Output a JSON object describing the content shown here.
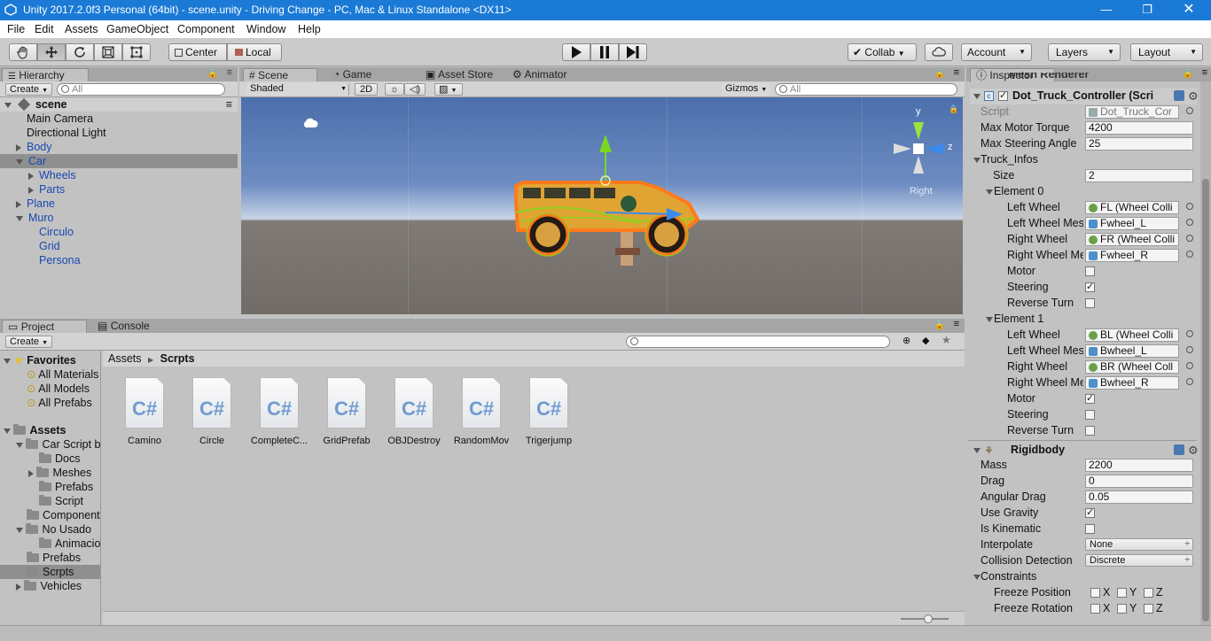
{
  "window": {
    "title": "Unity 2017.2.0f3 Personal (64bit) - scene.unity - Driving Change - PC, Mac & Linux Standalone <DX11>",
    "min_icon": "minimize-icon",
    "max_icon": "maximize-icon",
    "close_icon": "close-icon"
  },
  "menu": [
    "File",
    "Edit",
    "Assets",
    "GameObject",
    "Component",
    "Window",
    "Help"
  ],
  "toolbar": {
    "pivot": "Center",
    "space": "Local",
    "collab": "Collab",
    "account": "Account",
    "layers": "Layers",
    "layout": "Layout"
  },
  "hierarchy": {
    "tab": "Hierarchy",
    "create": "Create",
    "search_placeholder": "All",
    "scene": "scene",
    "items": [
      "Main Camera",
      "Directional Light",
      "Body",
      "Car",
      "Wheels",
      "Parts",
      "Plane",
      "Muro",
      "Circulo",
      "Grid",
      "Persona"
    ]
  },
  "scene_view": {
    "tabs": [
      "Scene",
      "Game",
      "Asset Store",
      "Animator"
    ],
    "shading": "Shaded",
    "mode_2d": "2D",
    "gizmos": "Gizmos",
    "search_placeholder": "All",
    "gizmo_axes": {
      "y": "y",
      "z": "z",
      "view": "Right"
    }
  },
  "project": {
    "tabs": [
      "Project",
      "Console"
    ],
    "create": "Create",
    "favorites_label": "Favorites",
    "favorites": [
      "All Materials",
      "All Models",
      "All Prefabs"
    ],
    "assets_label": "Assets",
    "tree": [
      "Car Script b",
      "Docs",
      "Meshes",
      "Prefabs",
      "Script",
      "Component",
      "No Usado",
      "Animacio",
      "Prefabs",
      "Scrpts",
      "Vehicles"
    ],
    "breadcrumb": [
      "Assets",
      "Scrpts"
    ],
    "files": [
      "Camino",
      "Circle",
      "CompleteC...",
      "GridPrefab",
      "OBJDestroy",
      "RandomMov",
      "Trigerjump"
    ],
    "file_badge": "C#"
  },
  "inspector": {
    "tab": "Inspector",
    "clipped_component": "Mesh Renderer",
    "component": "Dot_Truck_Controller (Scri",
    "script_label": "Script",
    "script_value": "Dot_Truck_Cor",
    "max_motor_torque_label": "Max Motor Torque",
    "max_motor_torque": "4200",
    "max_steering_angle_label": "Max Steering Angle",
    "max_steering_angle": "25",
    "truck_infos_label": "Truck_Infos",
    "size_label": "Size",
    "size": "2",
    "element0": {
      "label": "Element 0",
      "left_wheel_label": "Left Wheel",
      "left_wheel": "FL (Wheel Colli",
      "left_mesh_label": "Left Wheel Mes",
      "left_mesh": "Fwheel_L",
      "right_wheel_label": "Right Wheel",
      "right_wheel": "FR (Wheel Colli",
      "right_mesh_label": "Right Wheel Me",
      "right_mesh": "Fwheel_R",
      "motor_label": "Motor",
      "steering_label": "Steering",
      "reverse_label": "Reverse Turn",
      "motor": false,
      "steering": true,
      "reverse": false
    },
    "element1": {
      "label": "Element 1",
      "left_wheel_label": "Left Wheel",
      "left_wheel": "BL (Wheel Colli",
      "left_mesh_label": "Left Wheel Mes",
      "left_mesh": "Bwheel_L",
      "right_wheel_label": "Right Wheel",
      "right_wheel": "BR (Wheel Coll",
      "right_mesh_label": "Right Wheel Me",
      "right_mesh": "Bwheel_R",
      "motor_label": "Motor",
      "steering_label": "Steering",
      "reverse_label": "Reverse Turn",
      "motor": true,
      "steering": false,
      "reverse": false
    },
    "rigidbody": {
      "title": "Rigidbody",
      "mass_label": "Mass",
      "mass": "2200",
      "drag_label": "Drag",
      "drag": "0",
      "angular_drag_label": "Angular Drag",
      "angular_drag": "0.05",
      "use_gravity_label": "Use Gravity",
      "use_gravity": true,
      "is_kinematic_label": "Is Kinematic",
      "is_kinematic": false,
      "interpolate_label": "Interpolate",
      "interpolate": "None",
      "collision_label": "Collision Detection",
      "collision": "Discrete",
      "constraints_label": "Constraints",
      "freeze_pos_label": "Freeze Position",
      "freeze_rot_label": "Freeze Rotation",
      "axes": [
        "X",
        "Y",
        "Z"
      ]
    }
  },
  "colors": {
    "title_bar": "#1a7ad6",
    "panel_bg": "#c2c2c2",
    "selection": "#8f8f8f",
    "hierarchy_blue": "#1849b0",
    "car_outline": "#ff7a1a"
  }
}
